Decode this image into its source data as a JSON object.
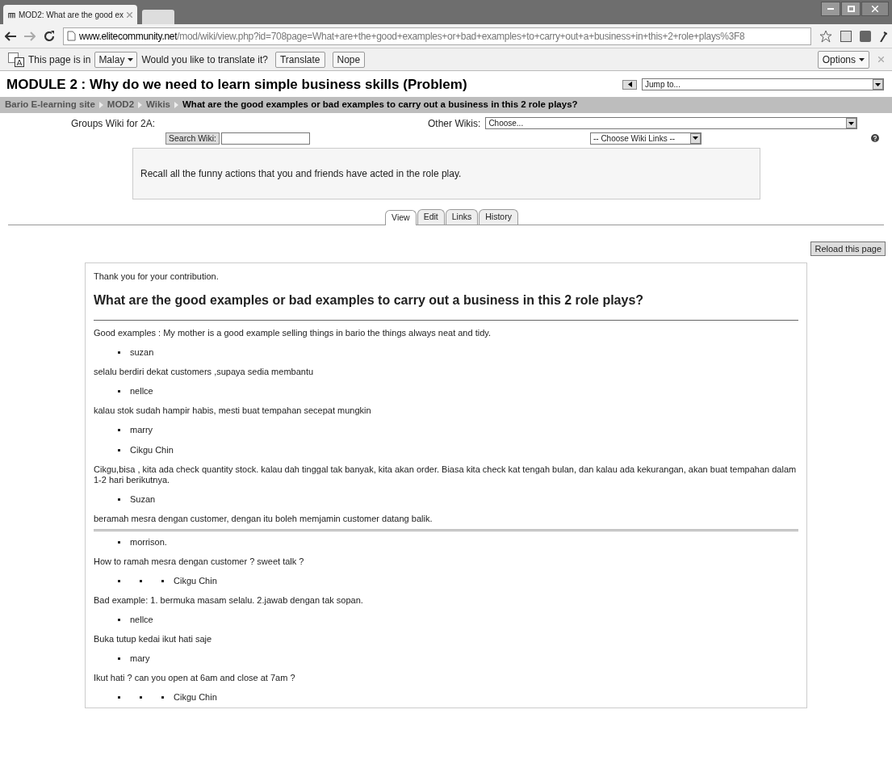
{
  "browser": {
    "tab_title": "MOD2: What are the good ex",
    "url_host": "www.elitecommunity.net",
    "url_path": "/mod/wiki/view.php?id=708page=What+are+the+good+examples+or+bad+examples+to+carry+out+a+business+in+this+2+role+plays%3F8"
  },
  "translate_bar": {
    "prefix": "This page is in",
    "language": "Malay",
    "question": "Would you like to translate it?",
    "buttons": [
      "Translate",
      "Nope"
    ],
    "options": "Options"
  },
  "page": {
    "title": "MODULE 2 : Why do we need to learn simple business skills (Problem)",
    "jump": "Jump to...",
    "breadcrumb": [
      {
        "label": "Bario E-learning site",
        "current": false
      },
      {
        "label": "MOD2",
        "current": false
      },
      {
        "label": "Wikis",
        "current": false
      },
      {
        "label": "What are the good examples or bad examples to carry out a business in this 2 role plays?",
        "current": true
      }
    ],
    "groups_label": "Groups Wiki for 2A:",
    "other_wikis_label": "Other Wikis:",
    "other_wikis_value": "Choose...",
    "search_button": "Search Wiki:",
    "wiki_links": "-- Choose Wiki Links --",
    "summary": "Recall all the funny actions that you and friends have acted in the role play.",
    "tabs": [
      {
        "label": "View",
        "selected": true
      },
      {
        "label": "Edit",
        "selected": false
      },
      {
        "label": "Links",
        "selected": false
      },
      {
        "label": "History",
        "selected": false
      }
    ],
    "reload": "Reload this page",
    "content": {
      "notice": "Thank you for your contribution.",
      "heading": "What are the good examples or bad examples to carry out a business in this 2 role plays?",
      "items": [
        {
          "kind": "paragraph",
          "text": "Good examples : My mother is a good example selling things in bario the things always neat and tidy."
        },
        {
          "kind": "bullet",
          "text": "suzan"
        },
        {
          "kind": "paragraph",
          "text": "selalu berdiri dekat customers ,supaya sedia membantu"
        },
        {
          "kind": "bullet",
          "text": "nellce"
        },
        {
          "kind": "paragraph",
          "text": "kalau stok sudah hampir habis, mesti buat tempahan secepat mungkin"
        },
        {
          "kind": "bullet",
          "text": "marry"
        },
        {
          "kind": "bullet",
          "text": "Cikgu Chin"
        },
        {
          "kind": "paragraph",
          "text": "Cikgu,bisa , kita ada check quantity stock. kalau dah tinggal tak banyak, kita akan order. Biasa kita check kat tengah bulan, dan kalau ada kekurangan, akan buat tempahan dalam 1-2 hari berikutnya."
        },
        {
          "kind": "bullet",
          "text": "Suzan"
        },
        {
          "kind": "paragraph",
          "text": "beramah mesra dengan customer, dengan itu boleh memjamin customer datang balik."
        },
        {
          "kind": "seam"
        },
        {
          "kind": "bullet",
          "text": "morrison."
        },
        {
          "kind": "paragraph",
          "text": "How to ramah mesra dengan customer ? sweet talk ?"
        },
        {
          "kind": "bullet",
          "children": [
            {
              "kind": "bullet",
              "children": [
                {
                  "kind": "bullet",
                  "text": "Cikgu Chin"
                }
              ]
            }
          ]
        },
        {
          "kind": "paragraph",
          "text": "Bad example: 1. bermuka masam selalu. 2.jawab dengan tak sopan."
        },
        {
          "kind": "bullet",
          "text": "nellce"
        },
        {
          "kind": "paragraph",
          "text": "Buka tutup kedai ikut hati saje"
        },
        {
          "kind": "bullet",
          "text": "mary"
        },
        {
          "kind": "paragraph",
          "text": "Ikut hati ? can you open at 6am and close at 7am ?"
        },
        {
          "kind": "bullet",
          "children": [
            {
              "kind": "bullet",
              "children": [
                {
                  "kind": "bullet",
                  "text": "Cikgu Chin"
                }
              ]
            }
          ]
        }
      ]
    }
  }
}
